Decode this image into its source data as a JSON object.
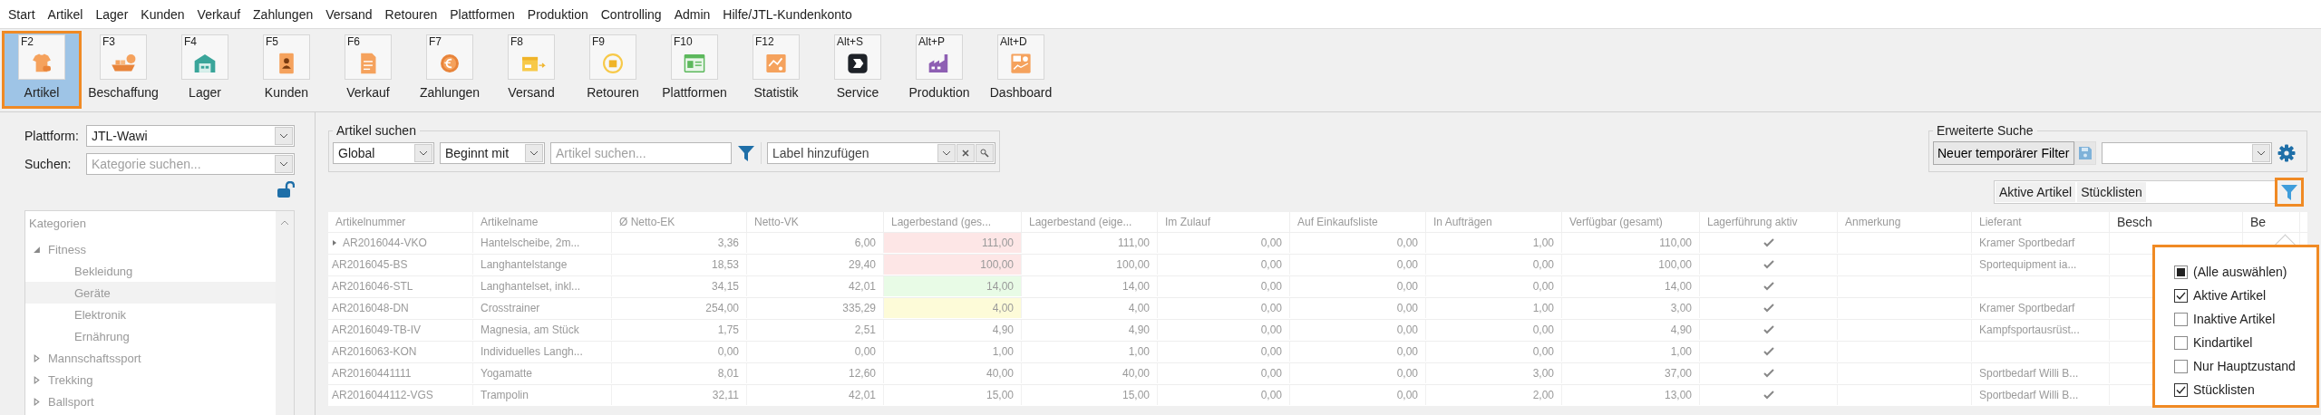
{
  "menu": [
    "Start",
    "Artikel",
    "Lager",
    "Kunden",
    "Verkauf",
    "Zahlungen",
    "Versand",
    "Retouren",
    "Plattformen",
    "Produktion",
    "Controlling",
    "Admin",
    "Hilfe/JTL-Kundenkonto"
  ],
  "toolbar": [
    {
      "hotkey": "F2",
      "label": "Artikel",
      "selected": true
    },
    {
      "hotkey": "F3",
      "label": "Beschaffung",
      "selected": false
    },
    {
      "hotkey": "F4",
      "label": "Lager",
      "selected": false
    },
    {
      "hotkey": "F5",
      "label": "Kunden",
      "selected": false
    },
    {
      "hotkey": "F6",
      "label": "Verkauf",
      "selected": false
    },
    {
      "hotkey": "F7",
      "label": "Zahlungen",
      "selected": false
    },
    {
      "hotkey": "F8",
      "label": "Versand",
      "selected": false
    },
    {
      "hotkey": "F9",
      "label": "Retouren",
      "selected": false
    },
    {
      "hotkey": "F10",
      "label": "Plattformen",
      "selected": false
    },
    {
      "hotkey": "F12",
      "label": "Statistik",
      "selected": false
    },
    {
      "hotkey": "Alt+S",
      "label": "Service",
      "selected": false
    },
    {
      "hotkey": "Alt+P",
      "label": "Produktion",
      "selected": false
    },
    {
      "hotkey": "Alt+D",
      "label": "Dashboard",
      "selected": false
    }
  ],
  "sidebar": {
    "platform_label": "Plattform:",
    "platform_value": "JTL-Wawi",
    "search_label": "Suchen:",
    "search_placeholder": "Kategorie suchen...",
    "tree": {
      "root": "Kategorien",
      "items": [
        {
          "label": "Fitness",
          "expanded": true,
          "selected": false,
          "children": [
            {
              "label": "Bekleidung",
              "selected": false
            },
            {
              "label": "Geräte",
              "selected": true
            },
            {
              "label": "Elektronik",
              "selected": false
            },
            {
              "label": "Ernährung",
              "selected": false
            }
          ]
        },
        {
          "label": "Mannschaftssport",
          "expanded": false,
          "selected": false
        },
        {
          "label": "Trekking",
          "expanded": false,
          "selected": false
        },
        {
          "label": "Ballsport",
          "expanded": false,
          "selected": false
        }
      ]
    }
  },
  "article_search": {
    "title": "Artikel suchen",
    "scope": "Global",
    "mode": "Beginnt mit",
    "search_placeholder": "Artikel suchen...",
    "label_placeholder": "Label hinzufügen"
  },
  "advanced_search": {
    "title": "Erweiterte Suche",
    "filter_button": "Neuer temporärer Filter"
  },
  "active_filters": [
    "Aktive Artikel",
    "Stücklisten"
  ],
  "table": {
    "columns": [
      "Artikelnummer",
      "Artikelname",
      "Ø Netto-EK",
      "Netto-VK",
      "Lagerbestand (ges...",
      "Lagerbestand (eige...",
      "Im Zulauf",
      "Auf Einkaufsliste",
      "In Aufträgen",
      "Verfügbar (gesamt)",
      "Lagerführung aktiv",
      "Anmerkung",
      "Lieferant",
      "Besch",
      "Be"
    ],
    "rows": [
      {
        "current": true,
        "color": "#fde6e6",
        "cells": [
          "AR2016044-VKO",
          "Hantelscheibe, 2m...",
          "3,36",
          "6,00",
          "111,00",
          "111,00",
          "0,00",
          "0,00",
          "1,00",
          "110,00"
        ],
        "stock_managed": true,
        "supplier": "Kramer Sportbedarf"
      },
      {
        "current": false,
        "color": "#fde6e6",
        "cells": [
          "AR2016045-BS",
          "Langhantelstange",
          "18,53",
          "29,40",
          "100,00",
          "100,00",
          "0,00",
          "0,00",
          "0,00",
          "100,00"
        ],
        "stock_managed": true,
        "supplier": "Sportequipment ia..."
      },
      {
        "current": false,
        "color": "#e8fbe6",
        "cells": [
          "AR2016046-STL",
          "Langhantelset, inkl...",
          "34,15",
          "42,01",
          "14,00",
          "14,00",
          "0,00",
          "0,00",
          "0,00",
          "14,00"
        ],
        "stock_managed": true
      },
      {
        "current": false,
        "color": "#fdfbd8",
        "cells": [
          "AR2016048-DN",
          "Crosstrainer",
          "254,00",
          "335,29",
          "4,00",
          "4,00",
          "0,00",
          "0,00",
          "1,00",
          "3,00"
        ],
        "stock_managed": true,
        "supplier": "Kramer Sportbedarf"
      },
      {
        "current": false,
        "cells": [
          "AR2016049-TB-IV",
          "Magnesia, am Stück",
          "1,75",
          "2,51",
          "4,90",
          "4,90",
          "0,00",
          "0,00",
          "0,00",
          "4,90"
        ],
        "stock_managed": true,
        "supplier": "Kampfsportausrüst..."
      },
      {
        "current": false,
        "cells": [
          "AR2016063-KON",
          "Individuelles Langh...",
          "0,00",
          "0,00",
          "1,00",
          "1,00",
          "0,00",
          "0,00",
          "0,00",
          "1,00"
        ],
        "stock_managed": true
      },
      {
        "current": false,
        "cells": [
          "AR20160441111",
          "Yogamatte",
          "8,01",
          "12,60",
          "40,00",
          "40,00",
          "0,00",
          "0,00",
          "3,00",
          "37,00"
        ],
        "stock_managed": true,
        "supplier": "Sportbedarf Willi B..."
      },
      {
        "current": false,
        "cells": [
          "AR2016044112-VGS",
          "Trampolin",
          "32,11",
          "42,01",
          "15,00",
          "15,00",
          "0,00",
          "0,00",
          "2,00",
          "13,00"
        ],
        "stock_managed": true,
        "supplier": "Sportbedarf Willi B..."
      }
    ]
  },
  "filter_popup": [
    {
      "label": "(Alle auswählen)",
      "checked": false,
      "indeterminate": true
    },
    {
      "label": "Aktive Artikel",
      "checked": true,
      "indeterminate": false
    },
    {
      "label": "Inaktive Artikel",
      "checked": false,
      "indeterminate": false
    },
    {
      "label": "Kindartikel",
      "checked": false,
      "indeterminate": false
    },
    {
      "label": "Nur Hauptzustand",
      "checked": false,
      "indeterminate": false
    },
    {
      "label": "Stücklisten",
      "checked": true,
      "indeterminate": false
    }
  ]
}
